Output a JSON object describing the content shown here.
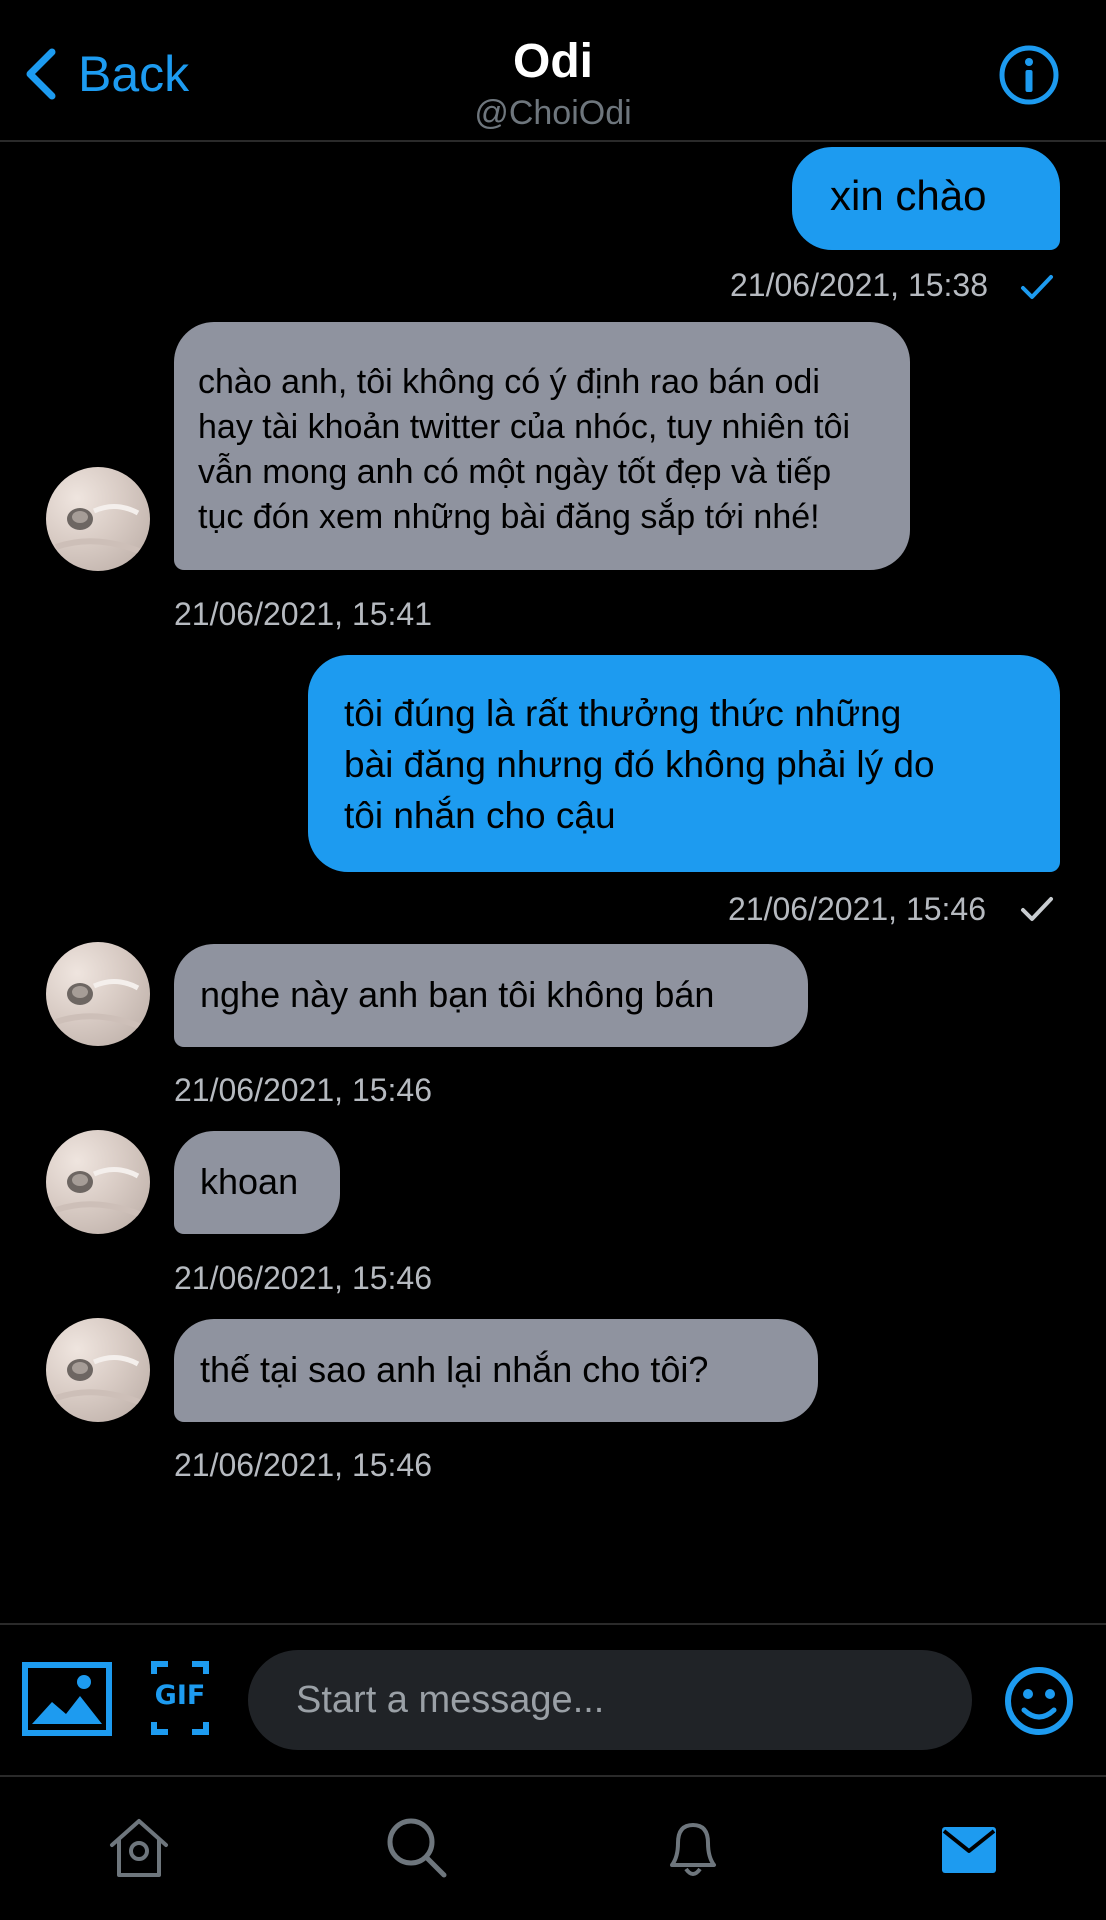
{
  "header": {
    "back_label": "Back",
    "title": "Odi",
    "handle": "@ChoiOdi"
  },
  "messages": [
    {
      "direction": "out",
      "text": "xin chào",
      "time": "21/06/2021, 15:38",
      "read_icon": "check-icon",
      "read_color": "#1d9bf0"
    },
    {
      "direction": "in",
      "lines": [
        "chào anh, tôi không có ý định rao bán odi",
        "hay tài khoản twitter của nhóc, tuy nhiên tôi",
        "vẫn mong anh có một ngày tốt đẹp và tiếp",
        "tục đón xem những bài đăng sắp tới nhé!"
      ],
      "time": "21/06/2021, 15:41"
    },
    {
      "direction": "out",
      "lines": [
        "tôi đúng là rất thưởng thức những",
        "bài đăng nhưng đó không phải lý do",
        "tôi nhắn cho cậu"
      ],
      "time": "21/06/2021, 15:46",
      "read_icon": "check-icon",
      "read_color": "#c8ccd0"
    },
    {
      "direction": "in",
      "text": "nghe này anh bạn tôi không bán",
      "time": "21/06/2021, 15:46"
    },
    {
      "direction": "in",
      "text": "khoan",
      "time": "21/06/2021, 15:46"
    },
    {
      "direction": "in",
      "text": "thế tại sao anh lại nhắn cho tôi?",
      "time": "21/06/2021, 15:46"
    }
  ],
  "composer": {
    "placeholder": "Start a message...",
    "gif_label": "GIF",
    "media_icon": "image-icon",
    "emoji_icon": "smiley-icon"
  },
  "bottom_nav": {
    "items": [
      "home-icon",
      "search-icon",
      "notifications-icon",
      "messages-icon"
    ],
    "active": "messages-icon"
  },
  "colors": {
    "accent": "#1d9bf0",
    "incoming_bubble": "#8f939f",
    "background": "#000000"
  }
}
